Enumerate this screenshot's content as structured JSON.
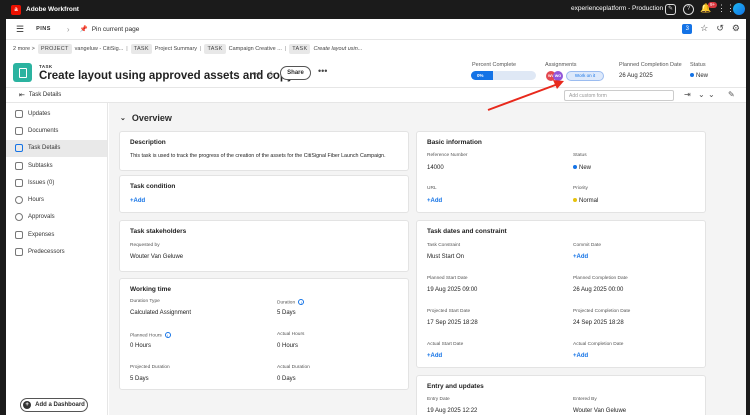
{
  "topbar": {
    "app_name": "Adobe Workfront",
    "logo_letter": "a",
    "environment": "experienceplatform - Production",
    "notif_count": "9+"
  },
  "pins": {
    "label": "PINS",
    "pin_current": "Pin current page",
    "counter": "3"
  },
  "breadcrumb": {
    "more": "2 more >",
    "items": [
      {
        "tag": "PROJECT",
        "text": "vangeluw - CitiSig..."
      },
      {
        "tag": "TASK",
        "text": "Project Summary"
      },
      {
        "tag": "TASK",
        "text": "Campaign Creative ..."
      },
      {
        "tag": "TASK",
        "text": "Create layout usin..."
      }
    ]
  },
  "task": {
    "type": "TASK",
    "title": "Create layout using approved assets and copy",
    "share": "Share",
    "percent_label": "Percent Complete",
    "percent_value": "0%",
    "assignments_label": "Assignments",
    "assignee_initials": [
      "WV",
      "WG"
    ],
    "work_on_it": "Work on it",
    "planned_label": "Planned Completion Date",
    "planned_value": "26 Aug 2025",
    "status_label": "Status",
    "status_value": "New"
  },
  "subbar": {
    "task_details": "Task Details",
    "custom_form_placeholder": "Add custom form"
  },
  "sidebar": {
    "items": [
      "Updates",
      "Documents",
      "Task Details",
      "Subtasks",
      "Issues (0)",
      "Hours",
      "Approvals",
      "Expenses",
      "Predecessors"
    ],
    "add_dashboard": "Add a Dashboard"
  },
  "overview": {
    "heading": "Overview",
    "description": {
      "title": "Description",
      "text": "This task is used to track the progress of the creation of the assets for the CitiSignal Fiber Launch Campaign."
    },
    "condition": {
      "title": "Task condition",
      "add": "+Add"
    },
    "stakeholders": {
      "title": "Task stakeholders",
      "requested_label": "Requested by",
      "requested_value": "Wouter Van Geluwe"
    },
    "working": {
      "title": "Working time",
      "duration_type_label": "Duration Type",
      "duration_type_value": "Calculated Assignment",
      "duration_label": "Duration",
      "duration_value": "5 Days",
      "planned_hours_label": "Planned Hours",
      "planned_hours_value": "0 Hours",
      "actual_hours_label": "Actual Hours",
      "actual_hours_value": "0 Hours",
      "projected_duration_label": "Projected Duration",
      "projected_duration_value": "5 Days",
      "actual_duration_label": "Actual Duration",
      "actual_duration_value": "0 Days"
    },
    "basic": {
      "title": "Basic information",
      "ref_label": "Reference Number",
      "ref_value": "14000",
      "status_label": "Status",
      "status_value": "New",
      "url_label": "URL",
      "url_add": "+Add",
      "priority_label": "Priority",
      "priority_value": "Normal"
    },
    "dates": {
      "title": "Task dates and constraint",
      "constraint_label": "Task Constraint",
      "constraint_value": "Must Start On",
      "commit_label": "Commit Date",
      "commit_add": "+Add",
      "pstart_label": "Planned Start Date",
      "pstart_value": "19 Aug 2025 09:00",
      "pcomp_label": "Planned Completion Date",
      "pcomp_value": "26 Aug 2025 00:00",
      "prstart_label": "Projected Start Date",
      "prstart_value": "17 Sep 2025 18:28",
      "prcomp_label": "Projected Completion Date",
      "prcomp_value": "24 Sep 2025 18:28",
      "astart_label": "Actual Start Date",
      "astart_add": "+Add",
      "acomp_label": "Actual Completion Date",
      "acomp_add": "+Add"
    },
    "entry": {
      "title": "Entry and updates",
      "entry_label": "Entry Date",
      "entry_value": "19 Aug 2025 12:22",
      "entered_label": "Entered By",
      "entered_value": "Wouter Van Geluwe"
    }
  },
  "colors": {
    "accent": "#1473e6",
    "task_icon": "#2bb3a0",
    "annotation_arrow": "#e8291c"
  }
}
